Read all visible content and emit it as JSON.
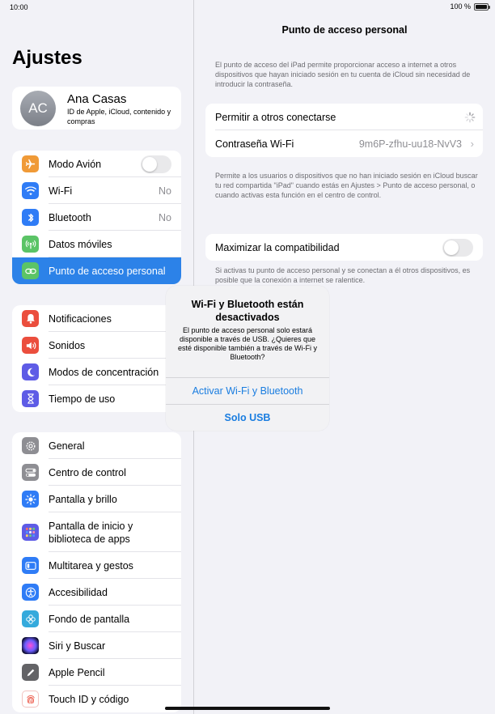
{
  "status": {
    "time": "10:00",
    "battery": "100 %"
  },
  "sidebar": {
    "title": "Ajustes",
    "profile": {
      "initials": "AC",
      "name": "Ana Casas",
      "subtitle": "ID de Apple, iCloud, contenido y compras"
    },
    "group1": [
      {
        "label": "Modo Avión",
        "icon": "airplane-icon",
        "color": "#f09a37"
      },
      {
        "label": "Wi-Fi",
        "value": "No",
        "icon": "wifi-icon",
        "color": "#2f7cf6"
      },
      {
        "label": "Bluetooth",
        "value": "No",
        "icon": "bluetooth-icon",
        "color": "#2f7cf6"
      },
      {
        "label": "Datos móviles",
        "icon": "antenna-icon",
        "color": "#5bc466"
      },
      {
        "label": "Punto de acceso personal",
        "icon": "hotspot-icon",
        "color": "#5bc466"
      }
    ],
    "group2": [
      {
        "label": "Notificaciones",
        "icon": "bell-icon",
        "color": "#eb4e3d"
      },
      {
        "label": "Sonidos",
        "icon": "speaker-icon",
        "color": "#eb4e3d"
      },
      {
        "label": "Modos de concentración",
        "icon": "moon-icon",
        "color": "#5e5ce6"
      },
      {
        "label": "Tiempo de uso",
        "icon": "hourglass-icon",
        "color": "#5e5ce6"
      }
    ],
    "group3": [
      {
        "label": "General",
        "icon": "gear-icon",
        "color": "#8e8e93"
      },
      {
        "label": "Centro de control",
        "icon": "switches-icon",
        "color": "#8e8e93"
      },
      {
        "label": "Pantalla y brillo",
        "icon": "sun-icon",
        "color": "#2f7cf6"
      },
      {
        "label": "Pantalla de inicio y biblioteca de apps",
        "icon": "apps-grid-icon",
        "color": "#5e5ce6"
      },
      {
        "label": "Multitarea y gestos",
        "icon": "multitask-icon",
        "color": "#2f7cf6"
      },
      {
        "label": "Accesibilidad",
        "icon": "accessibility-icon",
        "color": "#2f7cf6"
      },
      {
        "label": "Fondo de pantalla",
        "icon": "flower-icon",
        "color": "#35aadc"
      },
      {
        "label": "Siri y Buscar",
        "icon": "siri-icon",
        "color": "#222222"
      },
      {
        "label": "Apple Pencil",
        "icon": "pencil-icon",
        "color": "#636366"
      },
      {
        "label": "Touch ID y código",
        "icon": "fingerprint-icon",
        "color": "#eb4e3d"
      }
    ]
  },
  "detail": {
    "title": "Punto de acceso personal",
    "intro": "El punto de acceso del iPad permite proporcionar acceso a internet a otros dispositivos que hayan iniciado sesión en tu cuenta de iCloud sin necesidad de introducir la contraseña.",
    "allow_label": "Permitir a otros conectarse",
    "password_label": "Contraseña Wi-Fi",
    "password_value": "9m6P-zfhu-uu18-NvV3",
    "note": "Permite a los usuarios o dispositivos que no han iniciado sesión en iCloud buscar tu red compartida \"iPad\" cuando estás en Ajustes > Punto de acceso personal, o cuando activas esta función en el centro de control.",
    "compat_label": "Maximizar la compatibilidad",
    "compat_note": "Si activas tu punto de acceso personal y se conectan a él otros dispositivos, es posible que la conexión a internet se ralentice."
  },
  "alert": {
    "title": "Wi-Fi y Bluetooth están desactivados",
    "message": "El punto de acceso personal solo estará disponible a través de USB. ¿Quieres que esté disponible también a través de Wi-Fi y Bluetooth?",
    "primary": "Activar Wi-Fi y Bluetooth",
    "secondary": "Solo USB"
  },
  "colors": {
    "accent": "#1a7de0",
    "selected": "#2c82e8"
  }
}
